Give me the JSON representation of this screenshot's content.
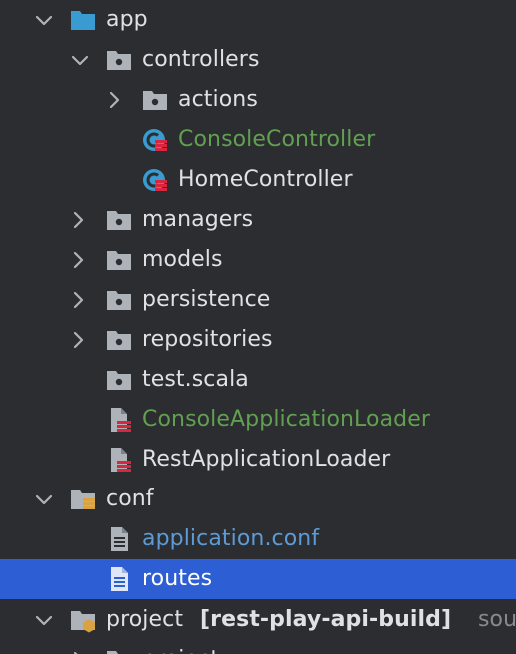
{
  "colors": {
    "background": "#2b2d30",
    "selection": "#2e5ed4",
    "folder_app": "#3a9bd1",
    "folder": "#aeb3ba",
    "modified_green": "#62a051",
    "config_blue": "#5d9bd6",
    "scala_red": "#d7263d"
  },
  "tree": {
    "app": {
      "label": "app",
      "icon": "source-folder-icon",
      "expanded": true
    },
    "controllers": {
      "label": "controllers",
      "icon": "package-folder-icon",
      "expanded": true
    },
    "actions": {
      "label": "actions",
      "icon": "package-folder-icon",
      "expanded": false
    },
    "console_controller": {
      "label": "ConsoleController",
      "icon": "scala-class-icon"
    },
    "home_controller": {
      "label": "HomeController",
      "icon": "scala-class-icon"
    },
    "managers": {
      "label": "managers",
      "icon": "package-folder-icon",
      "expanded": false
    },
    "models": {
      "label": "models",
      "icon": "package-folder-icon",
      "expanded": false
    },
    "persistence": {
      "label": "persistence",
      "icon": "package-folder-icon",
      "expanded": false
    },
    "repositories": {
      "label": "repositories",
      "icon": "package-folder-icon",
      "expanded": false
    },
    "test_scala": {
      "label": "test.scala",
      "icon": "package-folder-icon"
    },
    "console_application_loader": {
      "label": "ConsoleApplicationLoader",
      "icon": "scala-file-icon"
    },
    "rest_application_loader": {
      "label": "RestApplicationLoader",
      "icon": "scala-file-icon"
    },
    "conf": {
      "label": "conf",
      "icon": "resources-folder-icon",
      "expanded": true
    },
    "application_conf": {
      "label": "application.conf",
      "icon": "text-file-icon"
    },
    "routes": {
      "label": "routes",
      "icon": "text-file-icon",
      "selected": true
    },
    "project": {
      "label": "project",
      "module": "[rest-play-api-build]",
      "suffix": "sou",
      "icon": "project-folder-icon",
      "expanded": true
    },
    "project_child": {
      "label": "project",
      "icon": "package-folder-icon"
    }
  }
}
